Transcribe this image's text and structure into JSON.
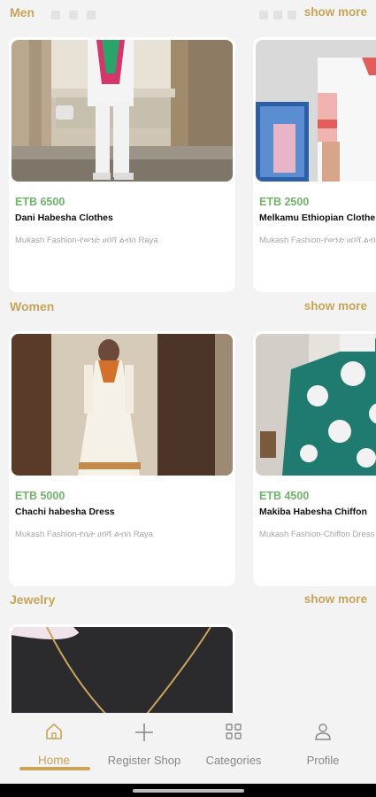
{
  "sections": [
    {
      "title": "Men",
      "show_more": "show more",
      "products": [
        {
          "price": "ETB 6500",
          "name": "Dani Habesha Clothes",
          "shop": "Mukash Fashion-የወንድ ሀበሻ ልብስ Raya"
        },
        {
          "price": "ETB 2500",
          "name": "Melkamu Ethiopian Clothe",
          "shop": "Mukash Fashion-የወንድ ሀበሻ ልብስ ዴሴ dese"
        }
      ]
    },
    {
      "title": "Women",
      "show_more": "show more",
      "products": [
        {
          "price": "ETB 5000",
          "name": "Chachi habesha Dress",
          "shop": "Mukash Fashion-የሴት ሀበሻ ልብስ Raya"
        },
        {
          "price": "ETB 4500",
          "name": "Makiba Habesha Chiffon",
          "shop": "Mukash Fashion-Chiffon Dress"
        }
      ]
    },
    {
      "title": "Jewelry",
      "show_more": "show more"
    }
  ],
  "nav": [
    {
      "label": "Home",
      "icon": "home-icon",
      "active": true
    },
    {
      "label": "Register Shop",
      "icon": "plus-icon",
      "active": false
    },
    {
      "label": "Categories",
      "icon": "categories-icon",
      "active": false
    },
    {
      "label": "Profile",
      "icon": "profile-icon",
      "active": false
    }
  ],
  "colors": {
    "accent": "#c9a45a",
    "price": "#6fb56a",
    "background": "#f3f3f3"
  }
}
